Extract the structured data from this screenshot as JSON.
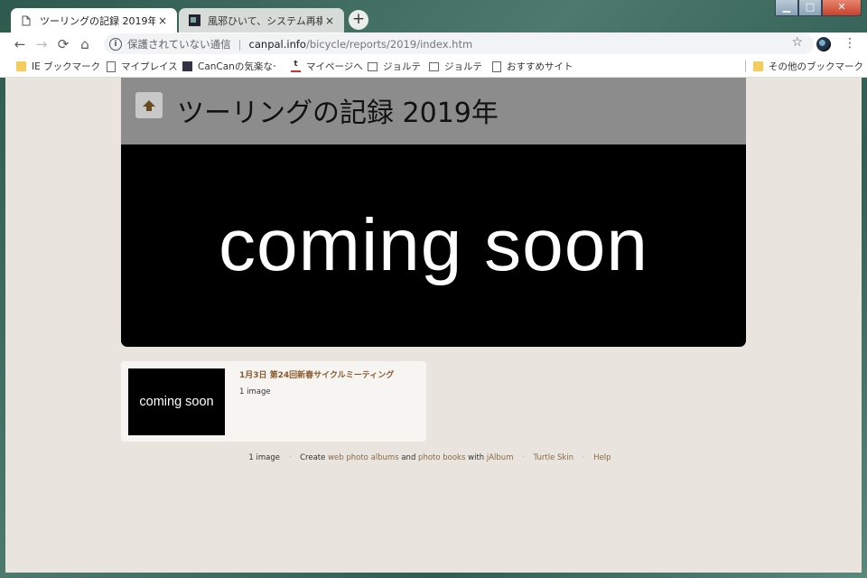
{
  "browser": {
    "tabs": [
      {
        "title": "ツーリングの記録 2019年",
        "close": "×"
      },
      {
        "title": "風邪ひいて、システム再構築 | C",
        "close": "×"
      }
    ],
    "new_tab": "+",
    "window_controls": {
      "minimize": "▁",
      "maximize": "□",
      "close": "✕"
    },
    "nav": {
      "back": "←",
      "forward": "→",
      "reload": "⟳",
      "home": "⌂"
    },
    "address": {
      "info": "i",
      "security_label": "保護されていない通信",
      "separator": "|",
      "host": "canpal.info",
      "path": "/bicycle/reports/2019/index.htm"
    },
    "star": "☆",
    "menu": "⋮",
    "bookmarks": [
      {
        "label": "IE ブックマーク",
        "icon": "folder-icon"
      },
      {
        "label": "マイプレイス",
        "icon": "page-icon"
      },
      {
        "label": "CanCanの気楽なー日",
        "icon": "site-icon"
      },
      {
        "label": "マイページへ",
        "icon": "site-icon"
      },
      {
        "label": "ジョルテ",
        "icon": "calendar-icon"
      },
      {
        "label": "ジョルテ",
        "icon": "calendar-icon"
      },
      {
        "label": "おすすめサイト",
        "icon": "page-icon"
      }
    ],
    "other_bookmarks": "その他のブックマーク"
  },
  "page": {
    "title": "ツーリングの記録 2019年",
    "hero_text": "coming soon",
    "album": {
      "thumb_text": "coming soon",
      "title": "1月3日 第24回新春サイクルミーティング",
      "count": "1 image"
    },
    "footer": {
      "count": "1 image",
      "create": "Create",
      "web_albums": "web photo albums",
      "and": "and",
      "photo_books": "photo books",
      "with": "with",
      "jalbum": "jAlbum",
      "skin": "Turtle Skin",
      "help": "Help",
      "dot": "·"
    }
  },
  "colors": {
    "page_bg": "#e9e4dd",
    "header_bg": "#8c8c8c",
    "link": "#8a6a4a",
    "album_title": "#8a5a2e"
  }
}
